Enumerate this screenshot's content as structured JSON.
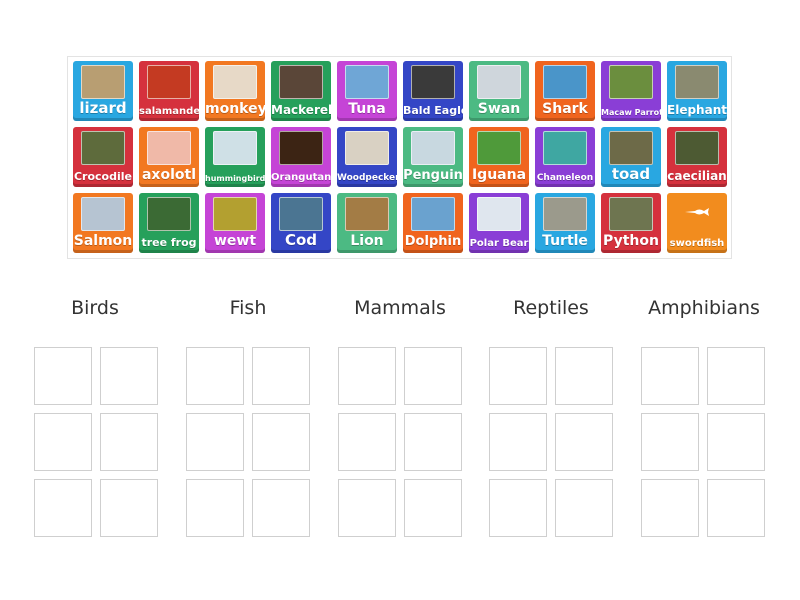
{
  "cards": [
    {
      "label": "lizard",
      "color": "#29a7e1",
      "pic": "#b89e72",
      "size": 15
    },
    {
      "label": "salamander",
      "color": "#d5313d",
      "pic": "#c43a22",
      "size": 10
    },
    {
      "label": "monkey",
      "color": "#f27821",
      "pic": "#e7d9c7",
      "size": 14
    },
    {
      "label": "Mackerel",
      "color": "#26a05b",
      "pic": "#5a4638",
      "size": 12
    },
    {
      "label": "Tuna",
      "color": "#c544d6",
      "pic": "#6fa6d6",
      "size": 14
    },
    {
      "label": "Bald Eagle",
      "color": "#3446c6",
      "pic": "#3a3a3a",
      "size": 11
    },
    {
      "label": "Swan",
      "color": "#4cba83",
      "pic": "#cfd6dc",
      "size": 14
    },
    {
      "label": "Shark",
      "color": "#f0641e",
      "pic": "#4a95c9",
      "size": 14
    },
    {
      "label": "Macaw Parrot",
      "color": "#8a3ed6",
      "pic": "#6b8e3e",
      "size": 8
    },
    {
      "label": "Elephant",
      "color": "#29a7e1",
      "pic": "#8a8a70",
      "size": 12
    },
    {
      "label": "Crocodile",
      "color": "#d5313d",
      "pic": "#5e6b3c",
      "size": 11
    },
    {
      "label": "axolotl",
      "color": "#f27821",
      "pic": "#f0b9a8",
      "size": 14
    },
    {
      "label": "hummingbird",
      "color": "#26a05b",
      "pic": "#cfe0e6",
      "size": 8
    },
    {
      "label": "Orangutan",
      "color": "#c544d6",
      "pic": "#3c2414",
      "size": 10
    },
    {
      "label": "Woodpecker",
      "color": "#3446c6",
      "pic": "#d9d1c3",
      "size": 9
    },
    {
      "label": "Penguin",
      "color": "#4cba83",
      "pic": "#c8d8e0",
      "size": 13
    },
    {
      "label": "Iguana",
      "color": "#f0641e",
      "pic": "#4f9a3a",
      "size": 14
    },
    {
      "label": "Chameleon",
      "color": "#8a3ed6",
      "pic": "#3fa7a2",
      "size": 9
    },
    {
      "label": "toad",
      "color": "#29a7e1",
      "pic": "#6d6a48",
      "size": 15
    },
    {
      "label": "caecilian",
      "color": "#d5313d",
      "pic": "#4d5a33",
      "size": 12
    },
    {
      "label": "Salmon",
      "color": "#f27821",
      "pic": "#b6c4d2",
      "size": 14
    },
    {
      "label": "tree frog",
      "color": "#26a05b",
      "pic": "#3b6a34",
      "size": 11
    },
    {
      "label": "wewt",
      "color": "#c544d6",
      "pic": "#b3a030",
      "size": 14
    },
    {
      "label": "Cod",
      "color": "#3446c6",
      "pic": "#4b7592",
      "size": 15
    },
    {
      "label": "Lion",
      "color": "#4cba83",
      "pic": "#a37c45",
      "size": 14
    },
    {
      "label": "Dolphin",
      "color": "#f0641e",
      "pic": "#6aa2cf",
      "size": 13
    },
    {
      "label": "Polar Bear",
      "color": "#8a3ed6",
      "pic": "#dfe6ee",
      "size": 10
    },
    {
      "label": "Turtle",
      "color": "#29a7e1",
      "pic": "#9b9a8c",
      "size": 14
    },
    {
      "label": "Python",
      "color": "#d5313d",
      "pic": "#6e7550",
      "size": 14
    },
    {
      "label": "swordfish",
      "color": "#f28c1e",
      "pic": "",
      "size": 10,
      "noimg": true
    }
  ],
  "groups": [
    {
      "title": "Birds"
    },
    {
      "title": "Fish"
    },
    {
      "title": "Mammals"
    },
    {
      "title": "Reptiles"
    },
    {
      "title": "Amphibians"
    }
  ]
}
